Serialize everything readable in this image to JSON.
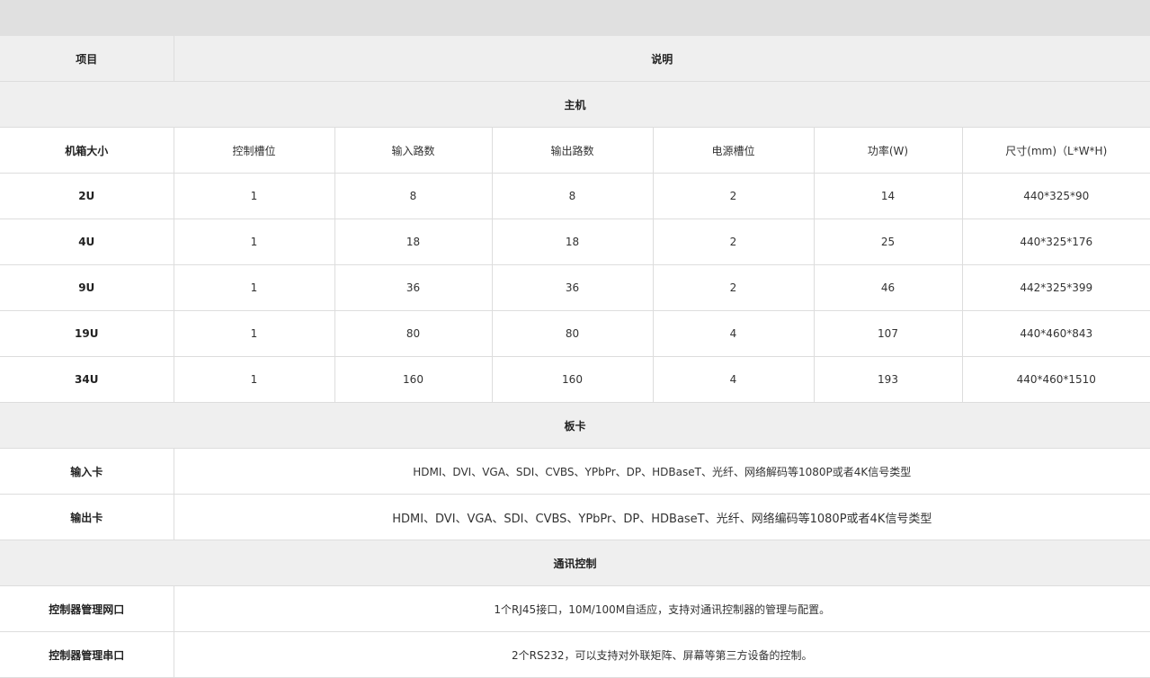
{
  "header": {
    "item": "项目",
    "desc": "说明"
  },
  "host": {
    "title": "主机",
    "columns": [
      "机箱大小",
      "控制槽位",
      "输入路数",
      "输出路数",
      "电源槽位",
      "功率(W)",
      "尺寸(mm)（L*W*H)"
    ],
    "rows": [
      [
        "2U",
        "1",
        "8",
        "8",
        "2",
        "14",
        "440*325*90"
      ],
      [
        "4U",
        "1",
        "18",
        "18",
        "2",
        "25",
        "440*325*176"
      ],
      [
        "9U",
        "1",
        "36",
        "36",
        "2",
        "46",
        "442*325*399"
      ],
      [
        "19U",
        "1",
        "80",
        "80",
        "4",
        "107",
        "440*460*843"
      ],
      [
        "34U",
        "1",
        "160",
        "160",
        "4",
        "193",
        "440*460*1510"
      ]
    ]
  },
  "cards": {
    "title": "板卡",
    "input": {
      "label": "输入卡",
      "value": "HDMI、DVI、VGA、SDI、CVBS、YPbPr、DP、HDBaseT、光纤、网络解码等1080P或者4K信号类型"
    },
    "output": {
      "label": "输出卡",
      "value": "HDMI、DVI、VGA、SDI、CVBS、YPbPr、DP、HDBaseT、光纤、网络编码等1080P或者4K信号类型"
    }
  },
  "comm": {
    "title": "通讯控制",
    "net": {
      "label": "控制器管理网口",
      "value": "1个RJ45接口，10M/100M自适应，支持对通讯控制器的管理与配置。"
    },
    "serial": {
      "label": "控制器管理串口",
      "value": "2个RS232，可以支持对外联矩阵、屏幕等第三方设备的控制。"
    }
  }
}
